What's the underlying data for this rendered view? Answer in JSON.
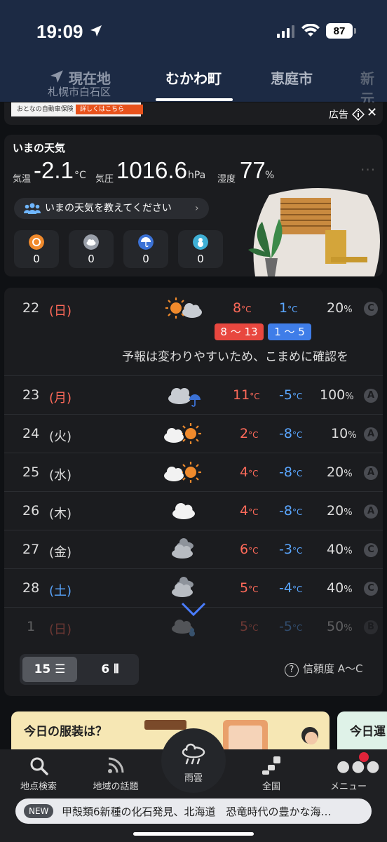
{
  "status": {
    "time": "19:09",
    "battery": "87"
  },
  "tabs": {
    "current_label": "現在地",
    "current_sub": "札幌市白石区",
    "active": "むかわ町",
    "next": "恵庭市",
    "partial": "新元"
  },
  "ad": {
    "banner_text": "おとなの自動車保険",
    "banner_button": "詳しくはこちら",
    "label": "広告"
  },
  "now": {
    "title": "いまの天気",
    "temp_label": "気温",
    "temp_value": "-2.1",
    "temp_unit": "°C",
    "pressure_label": "気圧",
    "pressure_value": "1016.6",
    "pressure_unit": "hPa",
    "humidity_label": "湿度",
    "humidity_value": "77",
    "humidity_unit": "%",
    "report_prompt": "いまの天気を教えてください",
    "reports": [
      {
        "icon": "sun-icon",
        "count": "0"
      },
      {
        "icon": "cloud-icon",
        "count": "0"
      },
      {
        "icon": "umbrella-icon",
        "count": "0"
      },
      {
        "icon": "snowman-icon",
        "count": "0"
      }
    ]
  },
  "forecast": {
    "days": [
      {
        "day": "22",
        "dow": "(日)",
        "dow_color": "#ff6a5a",
        "icon": "sun-cloud-icon",
        "hi": "8",
        "lo": "1",
        "pct": "20",
        "rel": "C"
      },
      {
        "day": "23",
        "dow": "(月)",
        "dow_color": "#ff6a5a",
        "icon": "cloud-rain-icon",
        "hi": "11",
        "lo": "-5",
        "pct": "100",
        "rel": "A"
      },
      {
        "day": "24",
        "dow": "(火)",
        "dow_color": "#dddddd",
        "icon": "cloud-sun-icon",
        "hi": "2",
        "lo": "-8",
        "pct": "10",
        "rel": "A"
      },
      {
        "day": "25",
        "dow": "(水)",
        "dow_color": "#dddddd",
        "icon": "cloud-sun-icon",
        "hi": "4",
        "lo": "-8",
        "pct": "20",
        "rel": "A"
      },
      {
        "day": "26",
        "dow": "(木)",
        "dow_color": "#dddddd",
        "icon": "cloud-icon",
        "hi": "4",
        "lo": "-8",
        "pct": "20",
        "rel": "A"
      },
      {
        "day": "27",
        "dow": "(金)",
        "dow_color": "#dddddd",
        "icon": "clouds-icon",
        "hi": "6",
        "lo": "-3",
        "pct": "40",
        "rel": "C"
      },
      {
        "day": "28",
        "dow": "(土)",
        "dow_color": "#5aa6ff",
        "icon": "clouds-icon",
        "hi": "5",
        "lo": "-4",
        "pct": "40",
        "rel": "C"
      },
      {
        "day": "1",
        "dow": "(日)",
        "dow_color": "#ff6a5a",
        "icon": "cloud-snow-icon",
        "hi": "5",
        "lo": "-5",
        "pct": "50",
        "rel": "B"
      }
    ],
    "unit_c": "°C",
    "unit_pct": "%",
    "hi_range": "8 ～ 13",
    "lo_range": "1 ～ 5",
    "note": "予報は変わりやすいため、こまめに確認を"
  },
  "toggle": {
    "on": "15 ☰",
    "off": "6 ⦀"
  },
  "reliability": "信頼度 A～C",
  "cards": {
    "main": "今日の服装は？",
    "side": "今日運"
  },
  "nav": {
    "search": "地点検索",
    "topics": "地域の話題",
    "rain": "雨雲",
    "national": "全国",
    "menu": "メニュー"
  },
  "news": {
    "badge": "NEW",
    "text": "甲殻類6新種の化石発見、北海道　恐竜時代の豊かな海…"
  },
  "colors": {
    "header": "#1c2a44",
    "hi": "#ff6a5a",
    "lo": "#5aa6ff",
    "hi_box": "#e8473f",
    "lo_box": "#3f7de8"
  }
}
